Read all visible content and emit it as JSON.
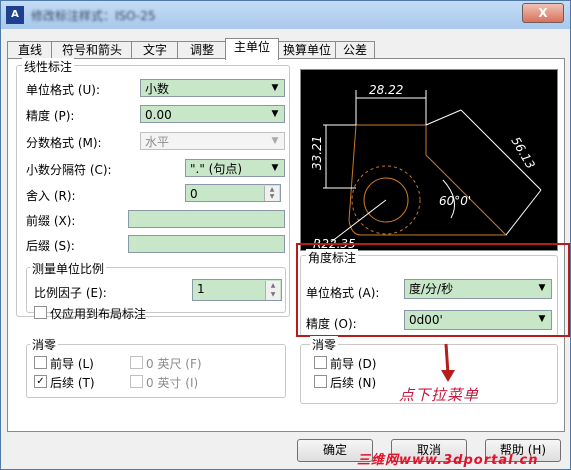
{
  "window": {
    "title": "修改标注样式：ISO-25",
    "close_label": "X",
    "app_icon": "autocad-icon"
  },
  "tabs": [
    {
      "label": "直线"
    },
    {
      "label": "符号和箭头"
    },
    {
      "label": "文字"
    },
    {
      "label": "调整"
    },
    {
      "label": "主单位"
    },
    {
      "label": "换算单位"
    },
    {
      "label": "公差"
    }
  ],
  "active_tab": "主单位",
  "linear": {
    "title": "线性标注",
    "unit_format_label": "单位格式 (U):",
    "unit_format_value": "小数",
    "precision_label": "精度 (P):",
    "precision_value": "0.00",
    "fraction_label": "分数格式 (M):",
    "fraction_value": "水平",
    "decimal_sep_label": "小数分隔符 (C):",
    "decimal_sep_value": "\".\" (句点)",
    "roundoff_label": "舍入 (R):",
    "roundoff_value": "0",
    "prefix_label": "前缀 (X):",
    "prefix_value": "",
    "suffix_label": "后缀 (S):",
    "suffix_value": ""
  },
  "scale": {
    "title": "测量单位比例",
    "factor_label": "比例因子 (E):",
    "factor_value": "1",
    "layout_only_label": "仅应用到布局标注"
  },
  "zero_left": {
    "title": "消零",
    "leading_label": "前导 (L)",
    "trailing_label": "后续 (T)",
    "feet_label": "0 英尺 (F)",
    "inches_label": "0 英寸 (I)",
    "leading_checked": false,
    "trailing_checked": true,
    "check_mark": "✓"
  },
  "angular": {
    "title": "角度标注",
    "unit_format_label": "单位格式 (A):",
    "unit_format_value": "度/分/秒",
    "precision_label": "精度 (O):",
    "precision_value": "0d00'"
  },
  "zero_right": {
    "title": "消零",
    "leading_label": "前导 (D)",
    "trailing_label": "后续 (N)"
  },
  "preview": {
    "dim_top": "28.22",
    "dim_left": "33.21",
    "dim_right": "56.13",
    "angle": "60°0'",
    "radius": "R22.35"
  },
  "annotation": "点下拉菜单",
  "buttons": {
    "ok": "确定",
    "cancel": "取消",
    "help": "帮助 (H)"
  },
  "watermark": "三维网www.3dportal.cn",
  "colors": {
    "field_bg": "#c8e6c8",
    "highlight": "#b51c1c",
    "annotation": "#c3183d",
    "preview_lines": "#c8782a"
  }
}
